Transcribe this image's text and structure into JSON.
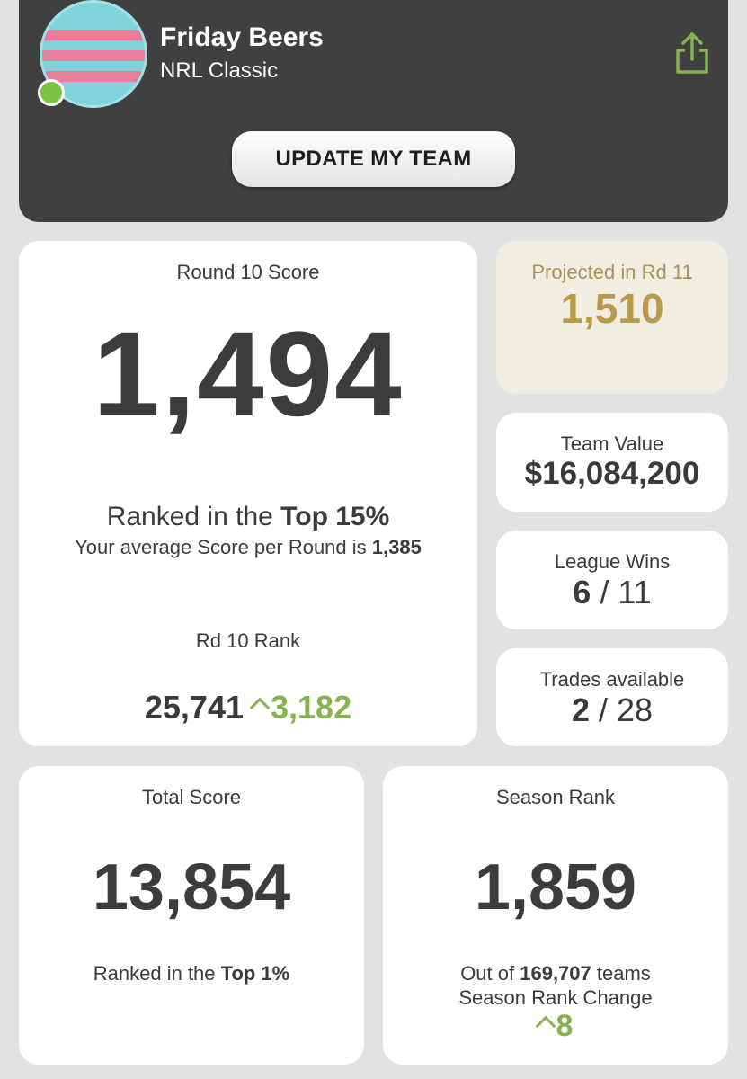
{
  "header": {
    "team_name": "Friday Beers",
    "competition": "NRL Classic",
    "update_button": "UPDATE MY TEAM",
    "share_icon": "share-icon",
    "status": "online"
  },
  "round": {
    "title": "Round 10 Score",
    "score": "1,494",
    "ranked_prefix": "Ranked in the ",
    "ranked_value": "Top 15%",
    "avg_prefix": "Your average Score per Round is ",
    "avg_value": "1,385",
    "rank_label": "Rd 10 Rank",
    "rank_value": "25,741",
    "rank_change": "3,182"
  },
  "projected": {
    "label": "Projected in Rd 11",
    "value": "1,510"
  },
  "team_value": {
    "label": "Team Value",
    "value": "$16,084,200"
  },
  "league_wins": {
    "label": "League Wins",
    "wins": "6",
    "separator": " / ",
    "total": "11"
  },
  "trades": {
    "label": "Trades available",
    "available": "2",
    "separator": " / ",
    "total": "28"
  },
  "total_score": {
    "label": "Total Score",
    "value": "13,854",
    "ranked_prefix": "Ranked in the ",
    "ranked_value": "Top 1%"
  },
  "season_rank": {
    "label": "Season Rank",
    "value": "1,859",
    "out_of_prefix": "Out of ",
    "out_of_value": "169,707",
    "out_of_suffix": " teams",
    "change_label": "Season Rank Change",
    "change_value": "8"
  },
  "colors": {
    "header_bg": "#404040",
    "accent_green": "#86b34e",
    "projected_bg": "#f1ede0",
    "projected_text": "#b89a4a",
    "page_bg": "#e2e2e2"
  }
}
